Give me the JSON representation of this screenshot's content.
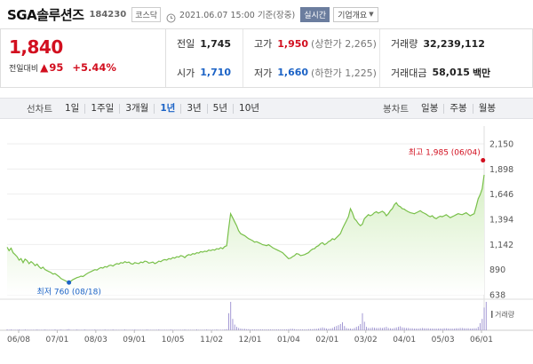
{
  "stock": {
    "name": "SGA솔루션즈",
    "code": "184230",
    "market": "코스닥",
    "datetime": "2021.06.07 15:00 기준(장중)",
    "realtime_label": "실시간",
    "company_label": "기업개요"
  },
  "price": {
    "now": "1,840",
    "change_label": "전일대비",
    "change": "95",
    "change_rate": "+5.44%"
  },
  "stats": {
    "prev_label": "전일",
    "prev": "1,745",
    "high_label": "고가",
    "high": "1,950",
    "upper_limit": "(상한가 2,265)",
    "volume_label": "거래량",
    "volume": "32,239,112",
    "open_label": "시가",
    "open": "1,710",
    "low_label": "저가",
    "low": "1,660",
    "lower_limit": "(하한가 1,225)",
    "amount_label": "거래대금",
    "amount": "58,015",
    "amount_unit": "백만"
  },
  "tabs": {
    "line_label": "선차트",
    "periods": [
      "1일",
      "1주일",
      "3개월",
      "1년",
      "3년",
      "5년",
      "10년"
    ],
    "active_period": "1년",
    "candle_label": "봉차트",
    "candles": [
      "일봉",
      "주봉",
      "월봉"
    ]
  },
  "colors": {
    "up": "#d20f1f",
    "down": "#1c63c6",
    "line": "#79c04a",
    "fill_top": "#d6efc4",
    "volume": "#9a8fd0"
  },
  "chart_data": {
    "type": "area",
    "ylim": [
      638,
      2150
    ],
    "y_ticks": [
      "2,150",
      "1,898",
      "1,646",
      "1,394",
      "1,142",
      "890",
      "638"
    ],
    "y_tick_values": [
      2150,
      1898,
      1646,
      1394,
      1142,
      890,
      638
    ],
    "x_tick_labels": [
      "06/08",
      "07/01",
      "08/03",
      "09/01",
      "10/05",
      "11/02",
      "12/01",
      "01/04",
      "02/01",
      "03/02",
      "04/01",
      "05/03",
      "06/01"
    ],
    "values": [
      1115,
      1080,
      1105,
      1060,
      1040,
      1020,
      985,
      1000,
      960,
      995,
      980,
      950,
      970,
      955,
      930,
      945,
      920,
      900,
      915,
      890,
      880,
      870,
      860,
      845,
      850,
      835,
      820,
      800,
      790,
      780,
      770,
      760,
      775,
      790,
      800,
      810,
      815,
      825,
      820,
      835,
      850,
      860,
      870,
      880,
      890,
      885,
      900,
      910,
      905,
      920,
      915,
      930,
      935,
      925,
      940,
      950,
      945,
      960,
      955,
      970,
      960,
      965,
      950,
      945,
      960,
      955,
      950,
      965,
      960,
      975,
      970,
      955,
      960,
      965,
      950,
      960,
      975,
      970,
      985,
      990,
      985,
      1000,
      995,
      1010,
      1005,
      1020,
      1015,
      1030,
      1025,
      1010,
      1030,
      1040,
      1035,
      1050,
      1045,
      1060,
      1055,
      1070,
      1065,
      1075,
      1070,
      1085,
      1080,
      1090,
      1085,
      1100,
      1095,
      1110,
      1100,
      1120,
      1130,
      1300,
      1450,
      1410,
      1370,
      1330,
      1280,
      1250,
      1240,
      1230,
      1215,
      1200,
      1190,
      1180,
      1165,
      1170,
      1160,
      1150,
      1140,
      1135,
      1130,
      1140,
      1125,
      1110,
      1100,
      1090,
      1080,
      1070,
      1060,
      1040,
      1020,
      1000,
      1005,
      1020,
      1030,
      1050,
      1045,
      1030,
      1035,
      1040,
      1050,
      1060,
      1080,
      1095,
      1100,
      1120,
      1130,
      1150,
      1160,
      1140,
      1150,
      1170,
      1180,
      1200,
      1190,
      1210,
      1230,
      1250,
      1300,
      1340,
      1380,
      1420,
      1500,
      1460,
      1400,
      1380,
      1350,
      1330,
      1345,
      1400,
      1420,
      1440,
      1430,
      1440,
      1460,
      1470,
      1455,
      1465,
      1475,
      1460,
      1430,
      1450,
      1480,
      1500,
      1540,
      1560,
      1530,
      1520,
      1500,
      1495,
      1480,
      1470,
      1460,
      1455,
      1450,
      1460,
      1470,
      1480,
      1465,
      1455,
      1445,
      1430,
      1420,
      1430,
      1410,
      1400,
      1415,
      1425,
      1420,
      1430,
      1440,
      1425,
      1410,
      1420,
      1430,
      1440,
      1450,
      1445,
      1440,
      1450,
      1460,
      1445,
      1430,
      1440,
      1450,
      1520,
      1600,
      1640,
      1700,
      1840
    ],
    "volume_values": [
      3,
      2,
      3,
      2,
      2,
      2,
      3,
      2,
      2,
      3,
      2,
      2,
      2,
      2,
      2,
      3,
      2,
      2,
      2,
      3,
      2,
      2,
      2,
      2,
      3,
      2,
      2,
      3,
      2,
      2,
      3,
      4,
      2,
      2,
      2,
      3,
      2,
      2,
      2,
      3,
      2,
      2,
      2,
      2,
      3,
      2,
      2,
      2,
      2,
      3,
      2,
      2,
      2,
      3,
      2,
      2,
      2,
      2,
      2,
      3,
      2,
      2,
      2,
      2,
      3,
      2,
      2,
      2,
      2,
      2,
      3,
      2,
      2,
      2,
      2,
      2,
      3,
      2,
      2,
      2,
      2,
      2,
      3,
      2,
      2,
      2,
      2,
      2,
      2,
      3,
      2,
      2,
      2,
      2,
      2,
      3,
      2,
      2,
      2,
      2,
      3,
      2,
      2,
      2,
      2,
      3,
      2,
      2,
      2,
      3,
      4,
      60,
      100,
      40,
      20,
      12,
      8,
      6,
      5,
      5,
      4,
      4,
      3,
      3,
      3,
      3,
      3,
      3,
      3,
      3,
      3,
      3,
      3,
      3,
      3,
      3,
      3,
      3,
      3,
      3,
      3,
      4,
      5,
      5,
      4,
      3,
      3,
      3,
      3,
      3,
      3,
      4,
      4,
      4,
      5,
      5,
      6,
      8,
      10,
      8,
      6,
      5,
      6,
      8,
      12,
      15,
      18,
      22,
      28,
      15,
      8,
      6,
      6,
      5,
      8,
      12,
      15,
      22,
      60,
      30,
      12,
      8,
      8,
      10,
      9,
      8,
      8,
      9,
      8,
      10,
      12,
      8,
      7,
      6,
      8,
      10,
      12,
      14,
      10,
      9,
      8,
      8,
      7,
      7,
      6,
      6,
      6,
      7,
      8,
      7,
      7,
      7,
      6,
      6,
      6,
      6,
      6,
      6,
      6,
      7,
      7,
      6,
      6,
      6,
      6,
      7,
      7,
      8,
      8,
      7,
      7,
      7,
      6,
      6,
      7,
      7,
      12,
      25,
      40,
      80,
      100
    ],
    "max_point": {
      "label": "최고 1,985 (06/04)",
      "value": 1985
    },
    "min_point": {
      "label": "최저 760 (08/18)",
      "value": 760
    },
    "volume_label": "거래량"
  }
}
